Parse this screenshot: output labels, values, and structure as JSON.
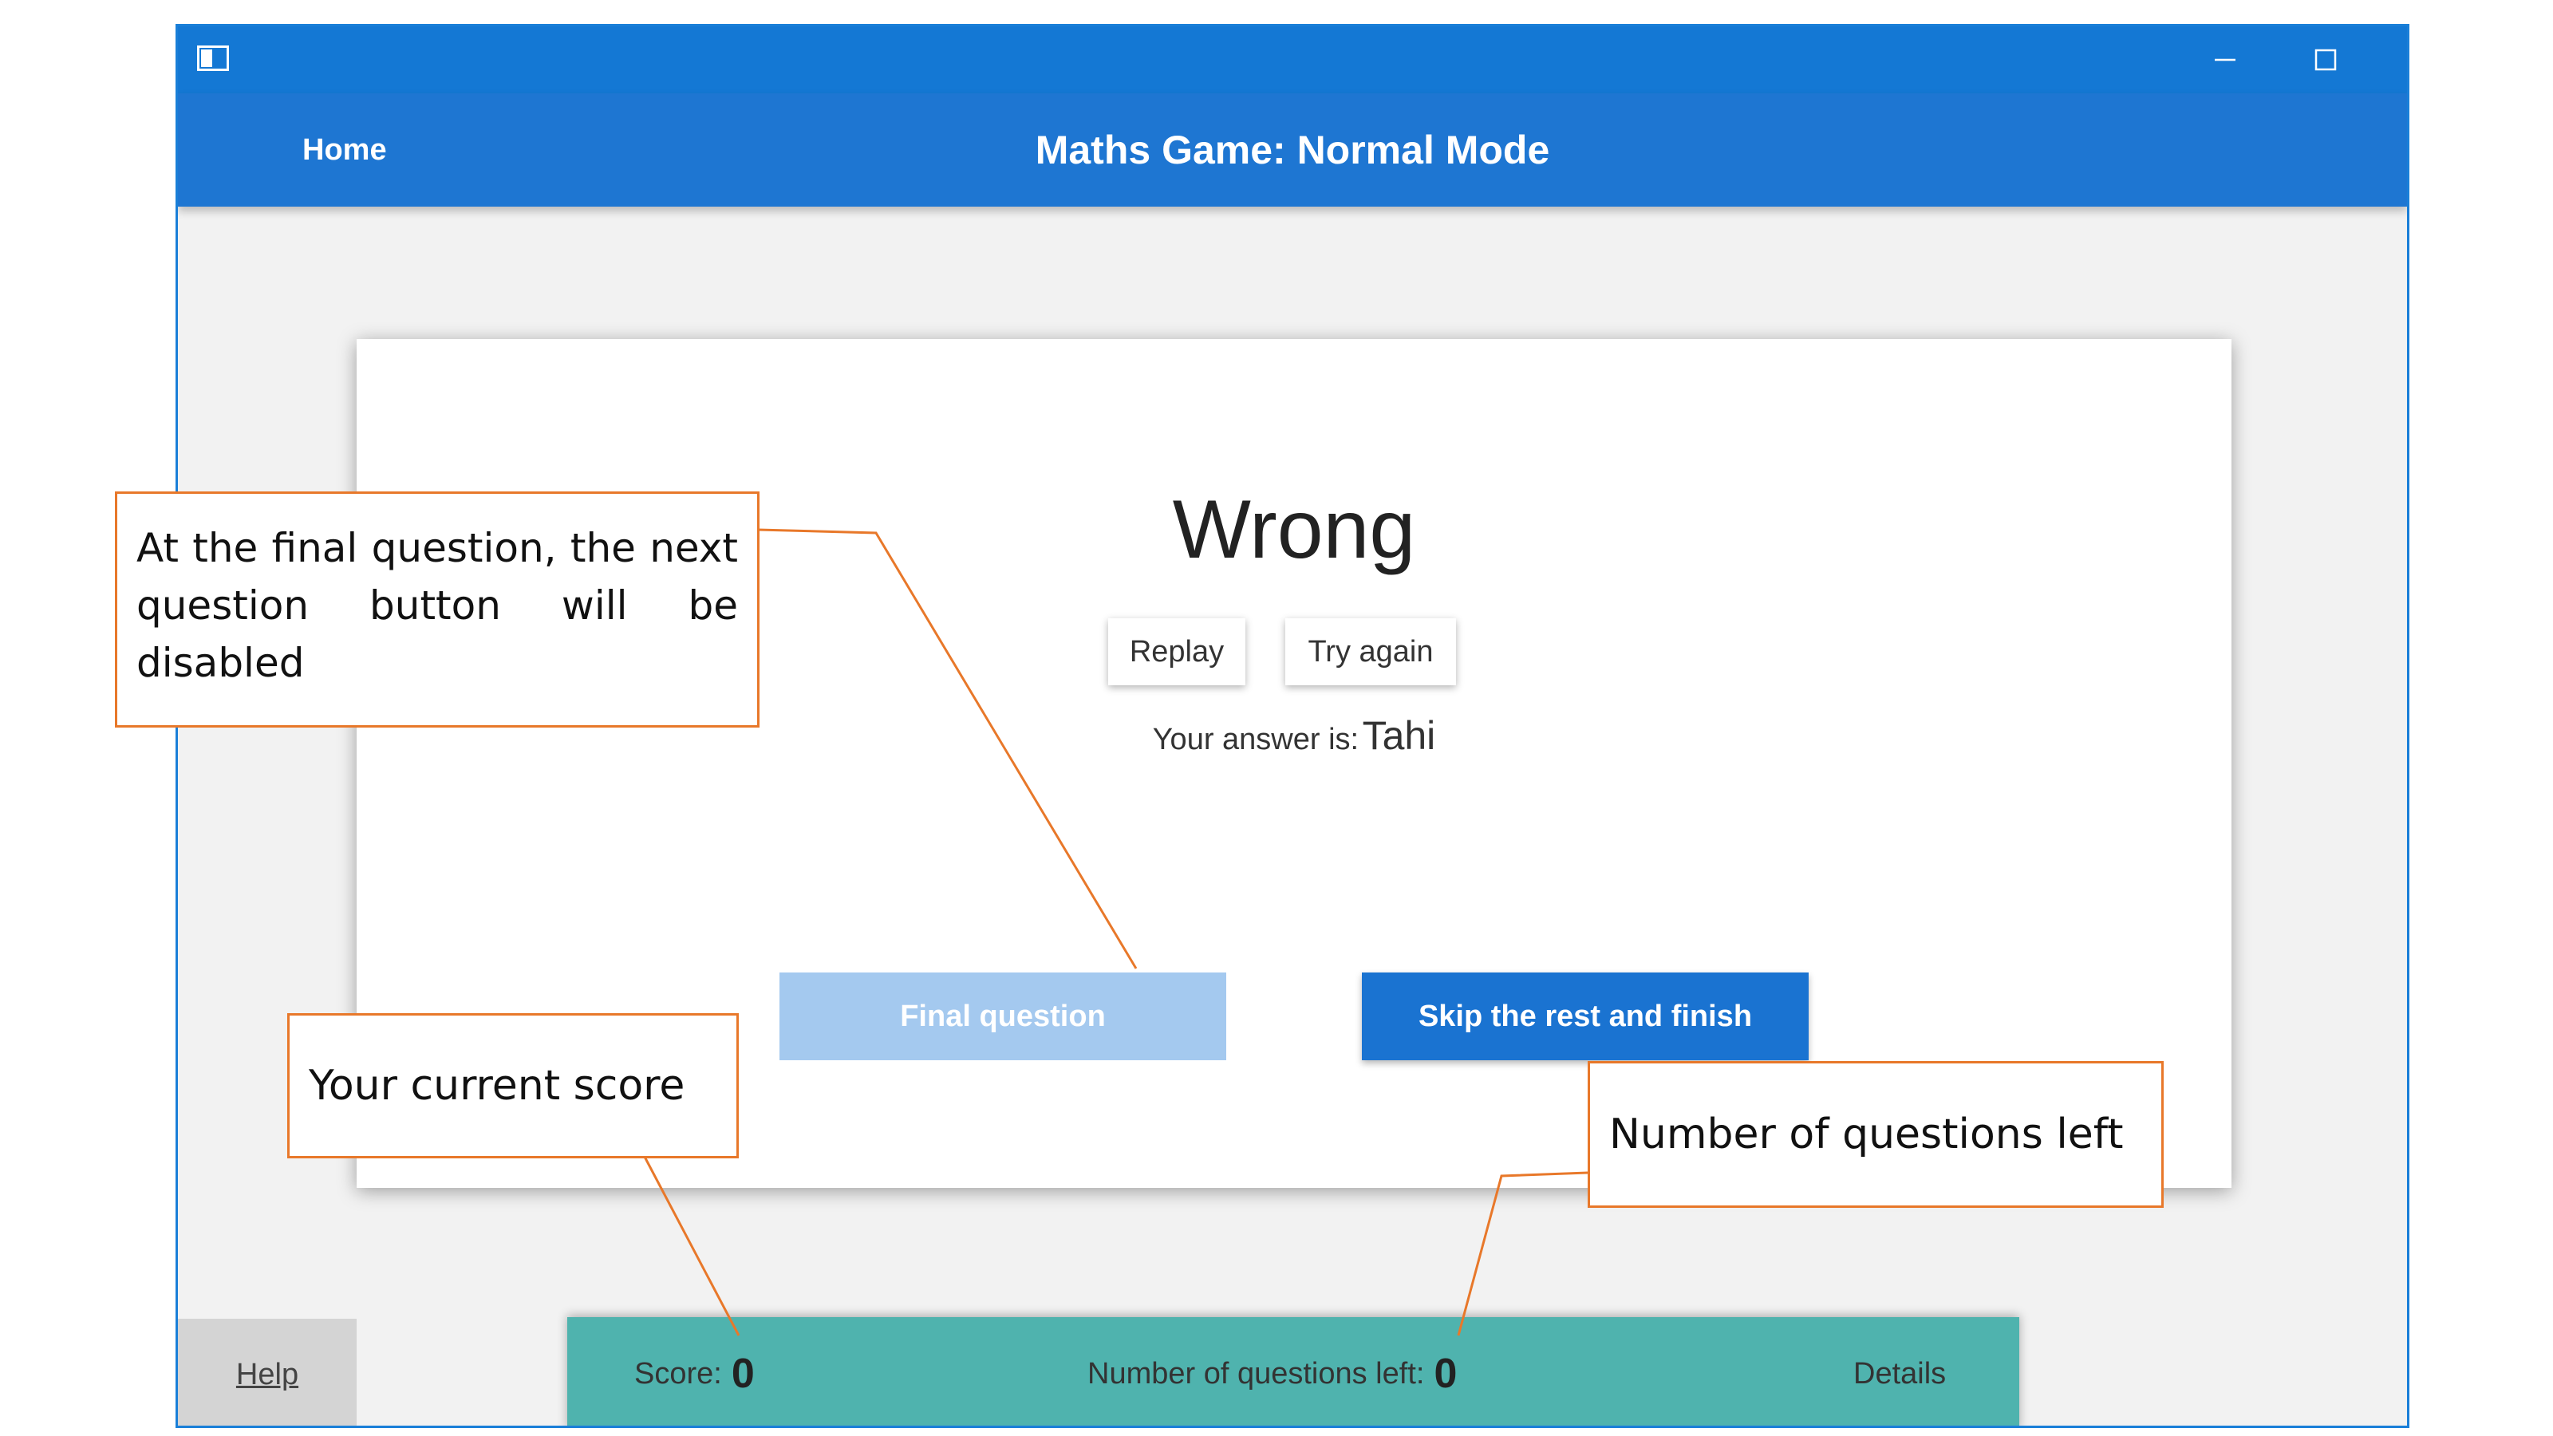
{
  "window": {
    "title_bar_buttons": [
      "minimize-icon",
      "maximize-icon",
      "close-icon"
    ]
  },
  "header": {
    "home": "Home",
    "title": "Maths Game: Normal Mode"
  },
  "card": {
    "result": "Wrong",
    "replay": "Replay",
    "try_again": "Try again",
    "answer_label": "Your answer is:",
    "answer_value": "Tahi",
    "final_question": "Final question",
    "skip": "Skip the rest and finish"
  },
  "footer": {
    "help": "Help",
    "score_label": "Score:",
    "score_value": "0",
    "questions_left_label": "Number of questions left:",
    "questions_left_value": "0",
    "details": "Details"
  },
  "annotations": {
    "final_question_note": "At the final question, the next question button will be disabled",
    "score_note": "Your current score",
    "questions_left_note": "Number of questions left"
  },
  "colors": {
    "title_bar": "#1478d4",
    "app_bar": "#1e76d2",
    "primary_button": "#1a73d1",
    "disabled_button": "#a4c9ef",
    "status_bar": "#4fb3ae",
    "callout_border": "#e8782a"
  }
}
